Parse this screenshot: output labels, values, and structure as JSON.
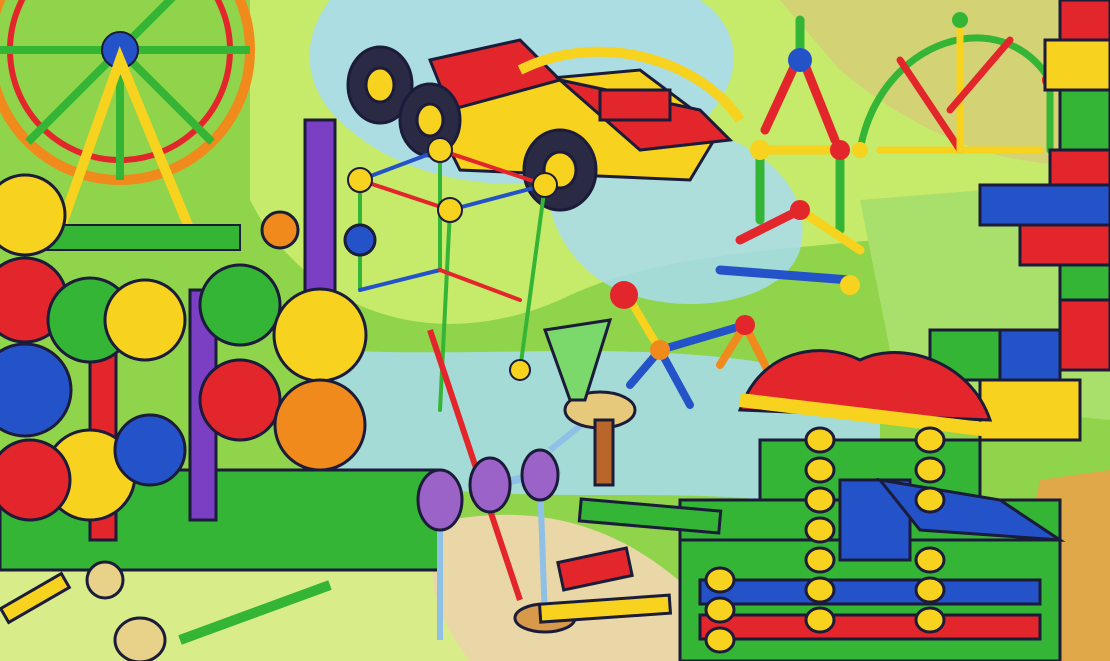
{
  "scene": {
    "subject": "toy-construction-sets",
    "palette": {
      "sky": "#7fd0e8",
      "grass": "#8fd44a",
      "grass_light": "#c6ea6a",
      "path": "#e9d7a8",
      "water": "#a8dcf0",
      "red": "#e3262b",
      "yellow": "#f7d21e",
      "blue": "#2453c9",
      "green": "#35b535",
      "purple": "#7a3fc2",
      "orange": "#f08a1c",
      "outline": "#1b1b3a"
    },
    "elements": [
      {
        "name": "ferris-wheel",
        "kind": "erector-set"
      },
      {
        "name": "race-car",
        "kind": "erector-set"
      },
      {
        "name": "gear-tower",
        "kind": "gears"
      },
      {
        "name": "tinkertoy-cube",
        "kind": "tinkertoy"
      },
      {
        "name": "magnetic-tower",
        "kind": "magnetic-rods"
      },
      {
        "name": "magnetic-dog",
        "kind": "magnetic-rods"
      },
      {
        "name": "magnetic-dome",
        "kind": "magnetic-rods"
      },
      {
        "name": "brick-wall",
        "kind": "interlocking-bricks"
      },
      {
        "name": "log-cabin",
        "kind": "lincoln-logs"
      },
      {
        "name": "tinkertoy-axle",
        "kind": "tinkertoy"
      }
    ]
  }
}
